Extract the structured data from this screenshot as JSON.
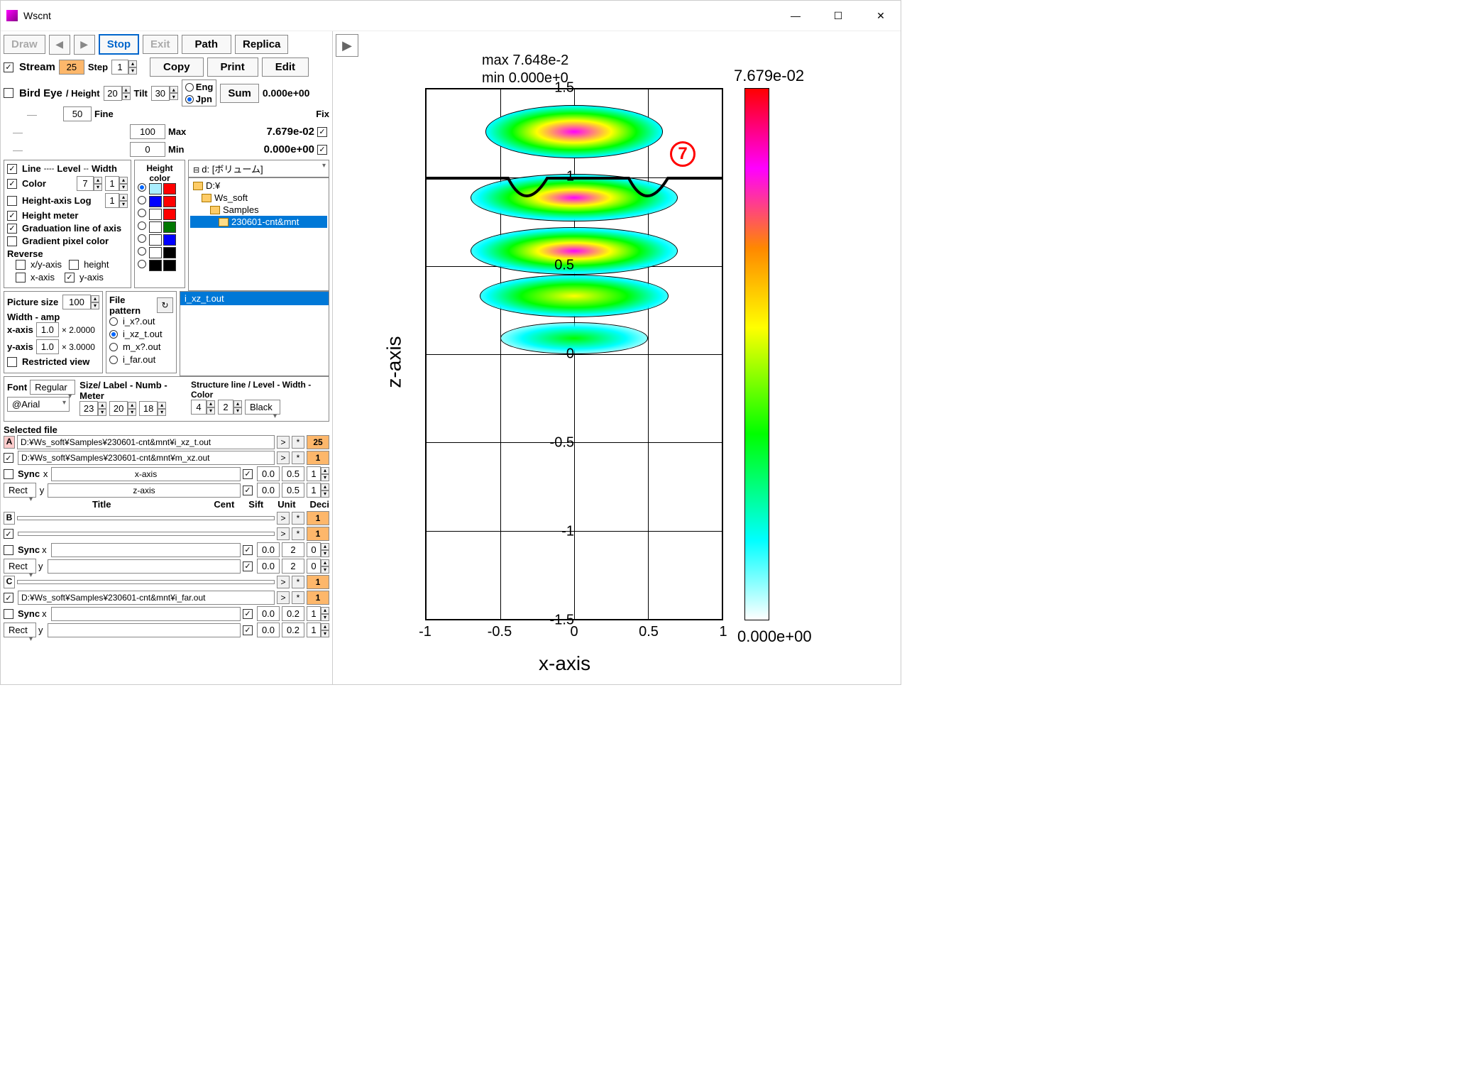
{
  "window": {
    "title": "Wscnt"
  },
  "toolbar": {
    "draw": "Draw",
    "stop": "Stop",
    "exit": "Exit",
    "path": "Path",
    "replica": "Replica",
    "copy": "Copy",
    "print": "Print",
    "edit": "Edit",
    "stream": "Stream",
    "stream_val": "25",
    "step": "Step",
    "step_val": "1",
    "birdeye": "Bird Eye",
    "height": "/ Height",
    "height_val": "20",
    "tilt": "Tilt",
    "tilt_val": "30",
    "fine": "Fine",
    "fine_val": "50",
    "eng": "Eng",
    "jpn": "Jpn",
    "sum": "Sum",
    "sum_val": "0.000e+00",
    "max": "Max",
    "max_val": "7.679e-02",
    "max_num": "100",
    "min": "Min",
    "min_val": "0.000e+00",
    "min_num": "0",
    "fix": "Fix"
  },
  "line_panel": {
    "line": "Line",
    "level": "Level",
    "width": "Width",
    "color": "Color",
    "color_val": "7",
    "width_val": "1",
    "height_log": "Height-axis Log",
    "height_log_val": "1",
    "height_meter": "Height meter",
    "grad_line": "Graduation line of axis",
    "grad_pixel": "Gradient pixel color",
    "reverse": "Reverse",
    "xy_axis": "x/y-axis",
    "height_rev": "height",
    "x_axis": "x-axis",
    "y_axis": "y-axis"
  },
  "height_color": {
    "title": "Height\ncolor"
  },
  "drive": {
    "label": "d: [ボリューム]"
  },
  "folders": {
    "root": "D:¥",
    "f1": "Ws_soft",
    "f2": "Samples",
    "f3": "230601-cnt&mnt"
  },
  "files": {
    "selected": "i_xz_t.out"
  },
  "picture": {
    "title": "Picture size",
    "size_val": "100",
    "width_amp": "Width - amp",
    "xaxis": "x-axis",
    "xaxis_val": "1.0",
    "xaxis_mult": "× 2.0000",
    "yaxis": "y-axis",
    "yaxis_val": "1.0",
    "yaxis_mult": "× 3.0000",
    "restricted": "Restricted view"
  },
  "file_pattern": {
    "title": "File pattern",
    "p1": "i_x?.out",
    "p2": "i_xz_t.out",
    "p3": "m_x?.out",
    "p4": "i_far.out"
  },
  "font_panel": {
    "font": "Font",
    "regular": "Regular",
    "arial": "@Arial",
    "size_label": "Size/ Label - Numb - Meter",
    "s1": "23",
    "s2": "20",
    "s3": "18",
    "struct": "Structure line / Level - Width - Color",
    "sl1": "4",
    "sl2": "2",
    "sl3": "Black"
  },
  "selected_file": {
    "title": "Selected file",
    "A_path": "D:¥Ws_soft¥Samples¥230601-cnt&mnt¥i_xz_t.out",
    "A_num": "25",
    "A2_path": "D:¥Ws_soft¥Samples¥230601-cnt&mnt¥m_xz.out",
    "A2_num": "1",
    "sync": "Sync",
    "x": "x",
    "y": "y",
    "x_label": "x-axis",
    "y_label": "z-axis",
    "x_val1": "0.0",
    "x_val2": "0.5",
    "x_val3": "1",
    "y_val1": "0.0",
    "y_val2": "0.5",
    "y_val3": "1",
    "rect": "Rect",
    "title_hdr": "Title",
    "cent": "Cent",
    "sift": "Sift",
    "unit": "Unit",
    "deci": "Deci",
    "B": "B",
    "B_num": "1",
    "B2_num": "1",
    "B_x1": "0.0",
    "B_x2": "2",
    "B_x3": "0",
    "B_y1": "0.0",
    "B_y2": "2",
    "B_y3": "0",
    "C": "C",
    "C_num": "1",
    "C2_path": "D:¥Ws_soft¥Samples¥230601-cnt&mnt¥i_far.out",
    "C2_num": "1",
    "C_x1": "0.0",
    "C_x2": "0.2",
    "C_x3": "1"
  },
  "callout": "7",
  "chart_data": {
    "type": "contour",
    "title_max": "max   7.648e-2",
    "title_min": "min    0.000e+0",
    "xlabel": "x-axis",
    "ylabel": "z-axis",
    "xlim": [
      -1.0,
      1.0
    ],
    "ylim": [
      -1.5,
      1.5
    ],
    "xticks": [
      -1.0,
      -0.5,
      0.0,
      0.5,
      1.0
    ],
    "yticks": [
      -1.5,
      -1.0,
      -0.5,
      0.0,
      0.5,
      1.0,
      1.5
    ],
    "colorbar_max": "7.679e-02",
    "colorbar_min": "0.000e+00",
    "peaks": [
      {
        "x": 0.0,
        "z": 1.25,
        "intensity": 0.065
      },
      {
        "x": 0.0,
        "z": 0.88,
        "intensity": 0.076
      },
      {
        "x": 0.0,
        "z": 0.6,
        "intensity": 0.075
      },
      {
        "x": 0.0,
        "z": 0.32,
        "intensity": 0.06
      },
      {
        "x": 0.0,
        "z": 0.08,
        "intensity": 0.03
      }
    ],
    "structure_line": {
      "type": "curve",
      "y_baseline": 1.0,
      "dips": [
        {
          "x": -0.35,
          "y": 0.8
        },
        {
          "x": 0.48,
          "y": 0.8
        }
      ]
    }
  }
}
